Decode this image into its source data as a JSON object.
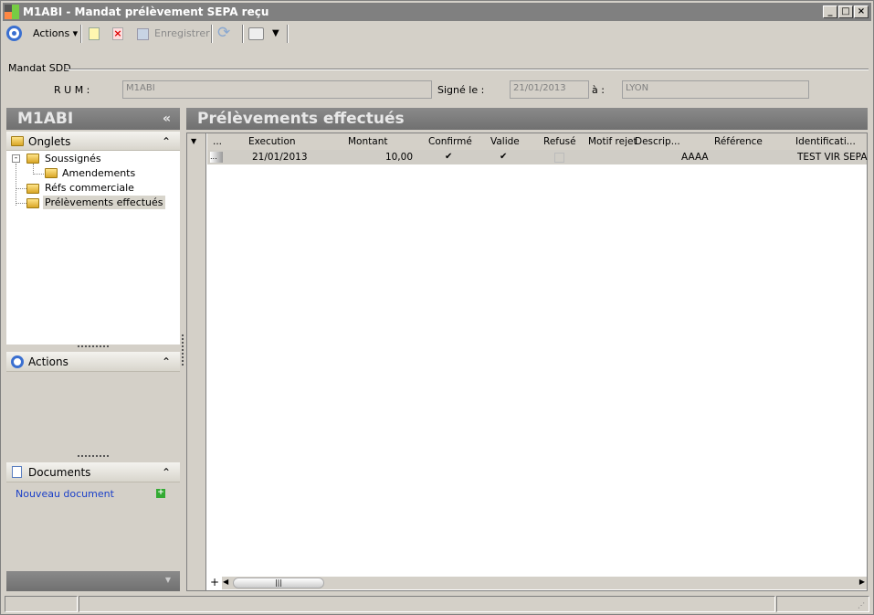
{
  "window": {
    "title": "M1ABI -  Mandat prélèvement SEPA reçu"
  },
  "toolbar": {
    "actions": "Actions",
    "save": "Enregistrer"
  },
  "form": {
    "group": "Mandat SDD",
    "rum_label": "R U M :",
    "rum": "M1ABI",
    "signed_label": "Signé le :",
    "signed": "21/01/2013",
    "at_label": "à :",
    "at": "LYON"
  },
  "left": {
    "title": "M1ABI",
    "tabs_header": "Onglets",
    "tree": [
      "Soussignés",
      "Amendements",
      "Réfs commerciale",
      "Prélèvements effectués"
    ],
    "actions_header": "Actions",
    "documents_header": "Documents",
    "new_document": "Nouveau document"
  },
  "main": {
    "title": "Prélèvements effectués",
    "columns": [
      "...",
      "Execution",
      "Montant",
      "Confirmé",
      "Valide",
      "Refusé",
      "Motif rejet",
      "Descrip...",
      "Référence",
      "Identificati..."
    ],
    "rows": [
      {
        "sel": "...",
        "execution": "21/01/2013",
        "montant": "10,00",
        "confirme": true,
        "valide": true,
        "refuse": false,
        "motif": "",
        "description": "AAAA",
        "reference": "",
        "identification": "TEST VIR SEPA",
        "check": "✔"
      }
    ],
    "add": "+"
  }
}
